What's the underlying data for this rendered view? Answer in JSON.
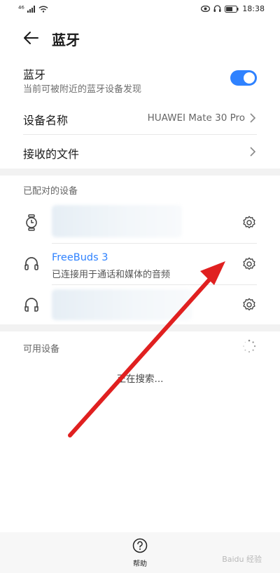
{
  "status": {
    "carrier": "⁴⁶",
    "time": "18:38"
  },
  "header": {
    "title": "蓝牙"
  },
  "bluetooth": {
    "label": "蓝牙",
    "subtitle": "当前可被附近的蓝牙设备发现",
    "enabled": true
  },
  "device_name": {
    "label": "设备名称",
    "value": "HUAWEI Mate 30 Pro"
  },
  "received_files": {
    "label": "接收的文件"
  },
  "paired": {
    "title": "已配对的设备",
    "devices": [
      {
        "icon": "watch-icon",
        "name": "",
        "subtitle": ""
      },
      {
        "icon": "headset-icon",
        "name": "FreeBuds 3",
        "subtitle": "已连接用于通话和媒体的音频"
      },
      {
        "icon": "headphones-icon",
        "name": "",
        "subtitle": ""
      }
    ]
  },
  "available": {
    "title": "可用设备",
    "searching": "正在搜索..."
  },
  "bottom": {
    "help_label": "帮助"
  },
  "watermark": "Baidu 经验",
  "colors": {
    "accent": "#2f82ff",
    "annotation_arrow": "#e02020"
  }
}
